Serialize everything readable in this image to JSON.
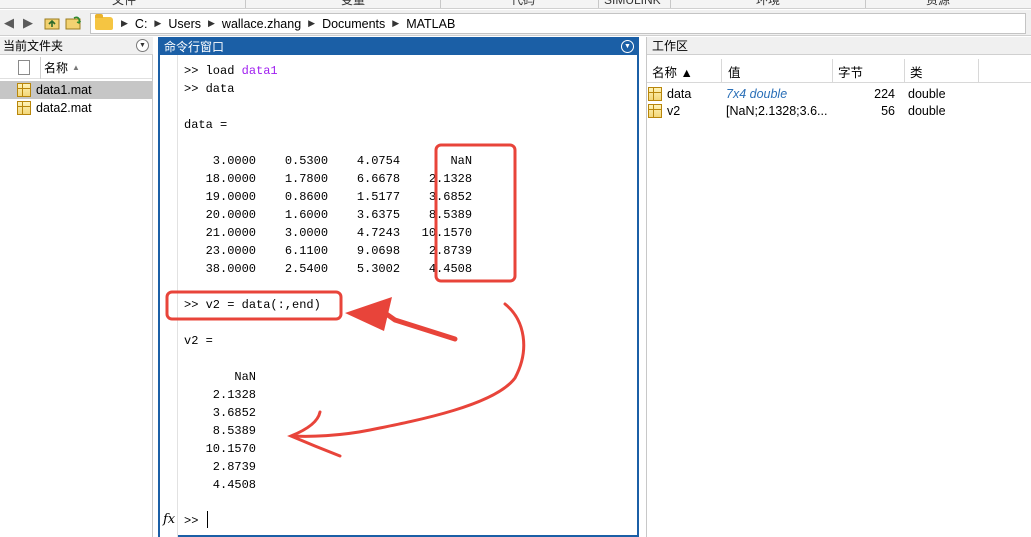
{
  "ribbon": {
    "tabs": [
      "文件",
      "变量",
      "代码",
      "SIMULINK",
      "环境",
      "资源"
    ]
  },
  "addressbar": {
    "path": [
      "C:",
      "Users",
      "wallace.zhang",
      "Documents",
      "MATLAB"
    ]
  },
  "current_folder": {
    "title": "当前文件夹",
    "col_name": "名称",
    "sort_indicator": "▲",
    "files": [
      {
        "name": "data1.mat",
        "selected": true
      },
      {
        "name": "data2.mat",
        "selected": false
      }
    ]
  },
  "command_window": {
    "title": "命令行窗口",
    "lines": [
      {
        "prompt": ">> ",
        "cmd": "load ",
        "arg": "data1"
      },
      {
        "prompt": ">> ",
        "cmd": "data",
        "arg": ""
      },
      {
        "text": "data ="
      },
      {
        "text": "    3.0000    0.5300    4.0754       NaN"
      },
      {
        "text": "   18.0000    1.7800    6.6678    2.1328"
      },
      {
        "text": "   19.0000    0.8600    1.5177    3.6852"
      },
      {
        "text": "   20.0000    1.6000    3.6375    8.5389"
      },
      {
        "text": "   21.0000    3.0000    4.7243   10.1570"
      },
      {
        "text": "   23.0000    6.1100    9.0698    2.8739"
      },
      {
        "text": "   38.0000    2.5400    5.3002    4.4508"
      },
      {
        "prompt": ">> ",
        "cmd": "v2 = data(:,end)",
        "arg": ""
      },
      {
        "text": "v2 ="
      },
      {
        "text": "       NaN"
      },
      {
        "text": "    2.1328"
      },
      {
        "text": "    3.6852"
      },
      {
        "text": "    8.5389"
      },
      {
        "text": "   10.1570"
      },
      {
        "text": "    2.8739"
      },
      {
        "text": "    4.4508"
      }
    ],
    "fx_symbol": "fx",
    "current_prompt": ">>"
  },
  "workspace": {
    "title": "工作区",
    "columns": [
      "名称 ▲",
      "值",
      "字节",
      "类"
    ],
    "vars": [
      {
        "name": "data",
        "value": "7x4 double",
        "bytes": "224",
        "class": "double",
        "value_is_link": true
      },
      {
        "name": "v2",
        "value": "[NaN;2.1328;3.6...",
        "bytes": "56",
        "class": "double",
        "value_is_link": false
      }
    ]
  },
  "colors": {
    "cmd_header": "#1b5fa6",
    "annotation": "#e8443a",
    "keyword": "#a020f0",
    "link": "#2a6fb7"
  }
}
